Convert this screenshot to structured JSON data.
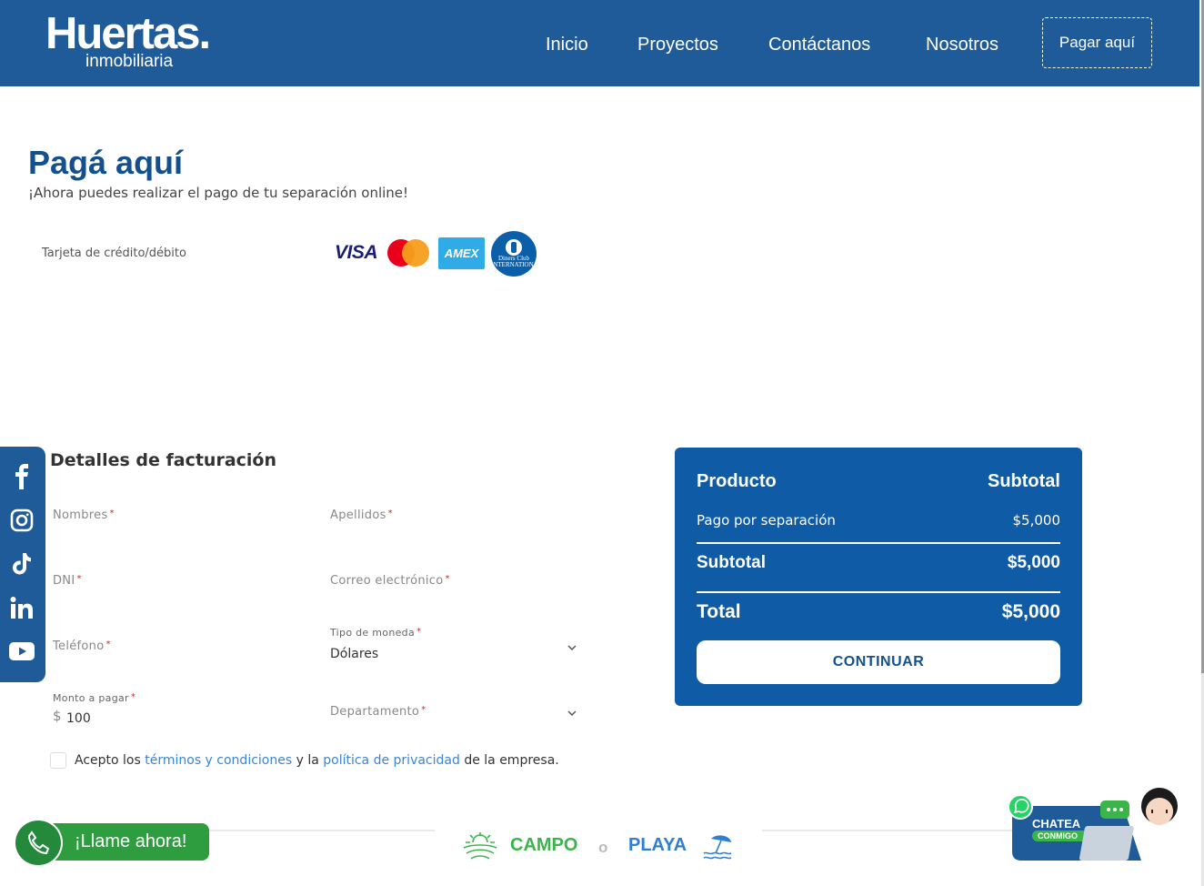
{
  "header": {
    "logo_main": "Huertas.",
    "logo_sub": "inmobiliaria",
    "nav": [
      "Inicio",
      "Proyectos",
      "Contáctanos",
      "Nosotros"
    ],
    "pay_button": "Pagar aquí"
  },
  "hero": {
    "title": "Pagá aquí",
    "subtitle": "¡Ahora puedes realizar el pago de tu separación online!",
    "card_label": "Tarjeta de crédito/débito",
    "card_brands": {
      "visa": "VISA",
      "amex": "AMEX",
      "diners": "Diners Club INTERNATIONAL"
    }
  },
  "social": [
    "facebook-icon",
    "instagram-icon",
    "tiktok-icon",
    "linkedin-icon",
    "youtube-icon"
  ],
  "billing": {
    "title": "Detalles de facturación",
    "fields": {
      "nombres": "Nombres",
      "apellidos": "Apellidos",
      "dni": "DNI",
      "correo": "Correo electrónico",
      "telefono": "Teléfono",
      "moneda_label": "Tipo de moneda",
      "moneda_value": "Dólares",
      "monto_label": "Monto a pagar",
      "monto_currency": "$",
      "monto_value": "100",
      "departamento": "Departamento"
    },
    "required_mark": "*",
    "terms": {
      "prefix": "Acepto los ",
      "link1": "términos y condiciones",
      "middle": " y la ",
      "link2": "política de privacidad",
      "suffix": " de la empresa."
    }
  },
  "summary": {
    "col_product": "Producto",
    "col_subtotal": "Subtotal",
    "item_name": "Pago por separación",
    "item_price": "$5,000",
    "subtotal_label": "Subtotal",
    "subtotal_value": "$5,000",
    "total_label": "Total",
    "total_value": "$5,000",
    "continue": "CONTINUAR"
  },
  "footer": {
    "campo": "CAMPO",
    "sep": "o",
    "playa": "PLAYA",
    "call": "¡Llame ahora!",
    "chat_title": "CHATEA",
    "chat_sub": "CONMIGO"
  },
  "colors": {
    "header": "#1f5b99",
    "title": "#14508e",
    "summary": "#0f5ba5",
    "campo": "#3bb54a",
    "playa": "#2f7fd1",
    "call": "#2d9d3f"
  }
}
